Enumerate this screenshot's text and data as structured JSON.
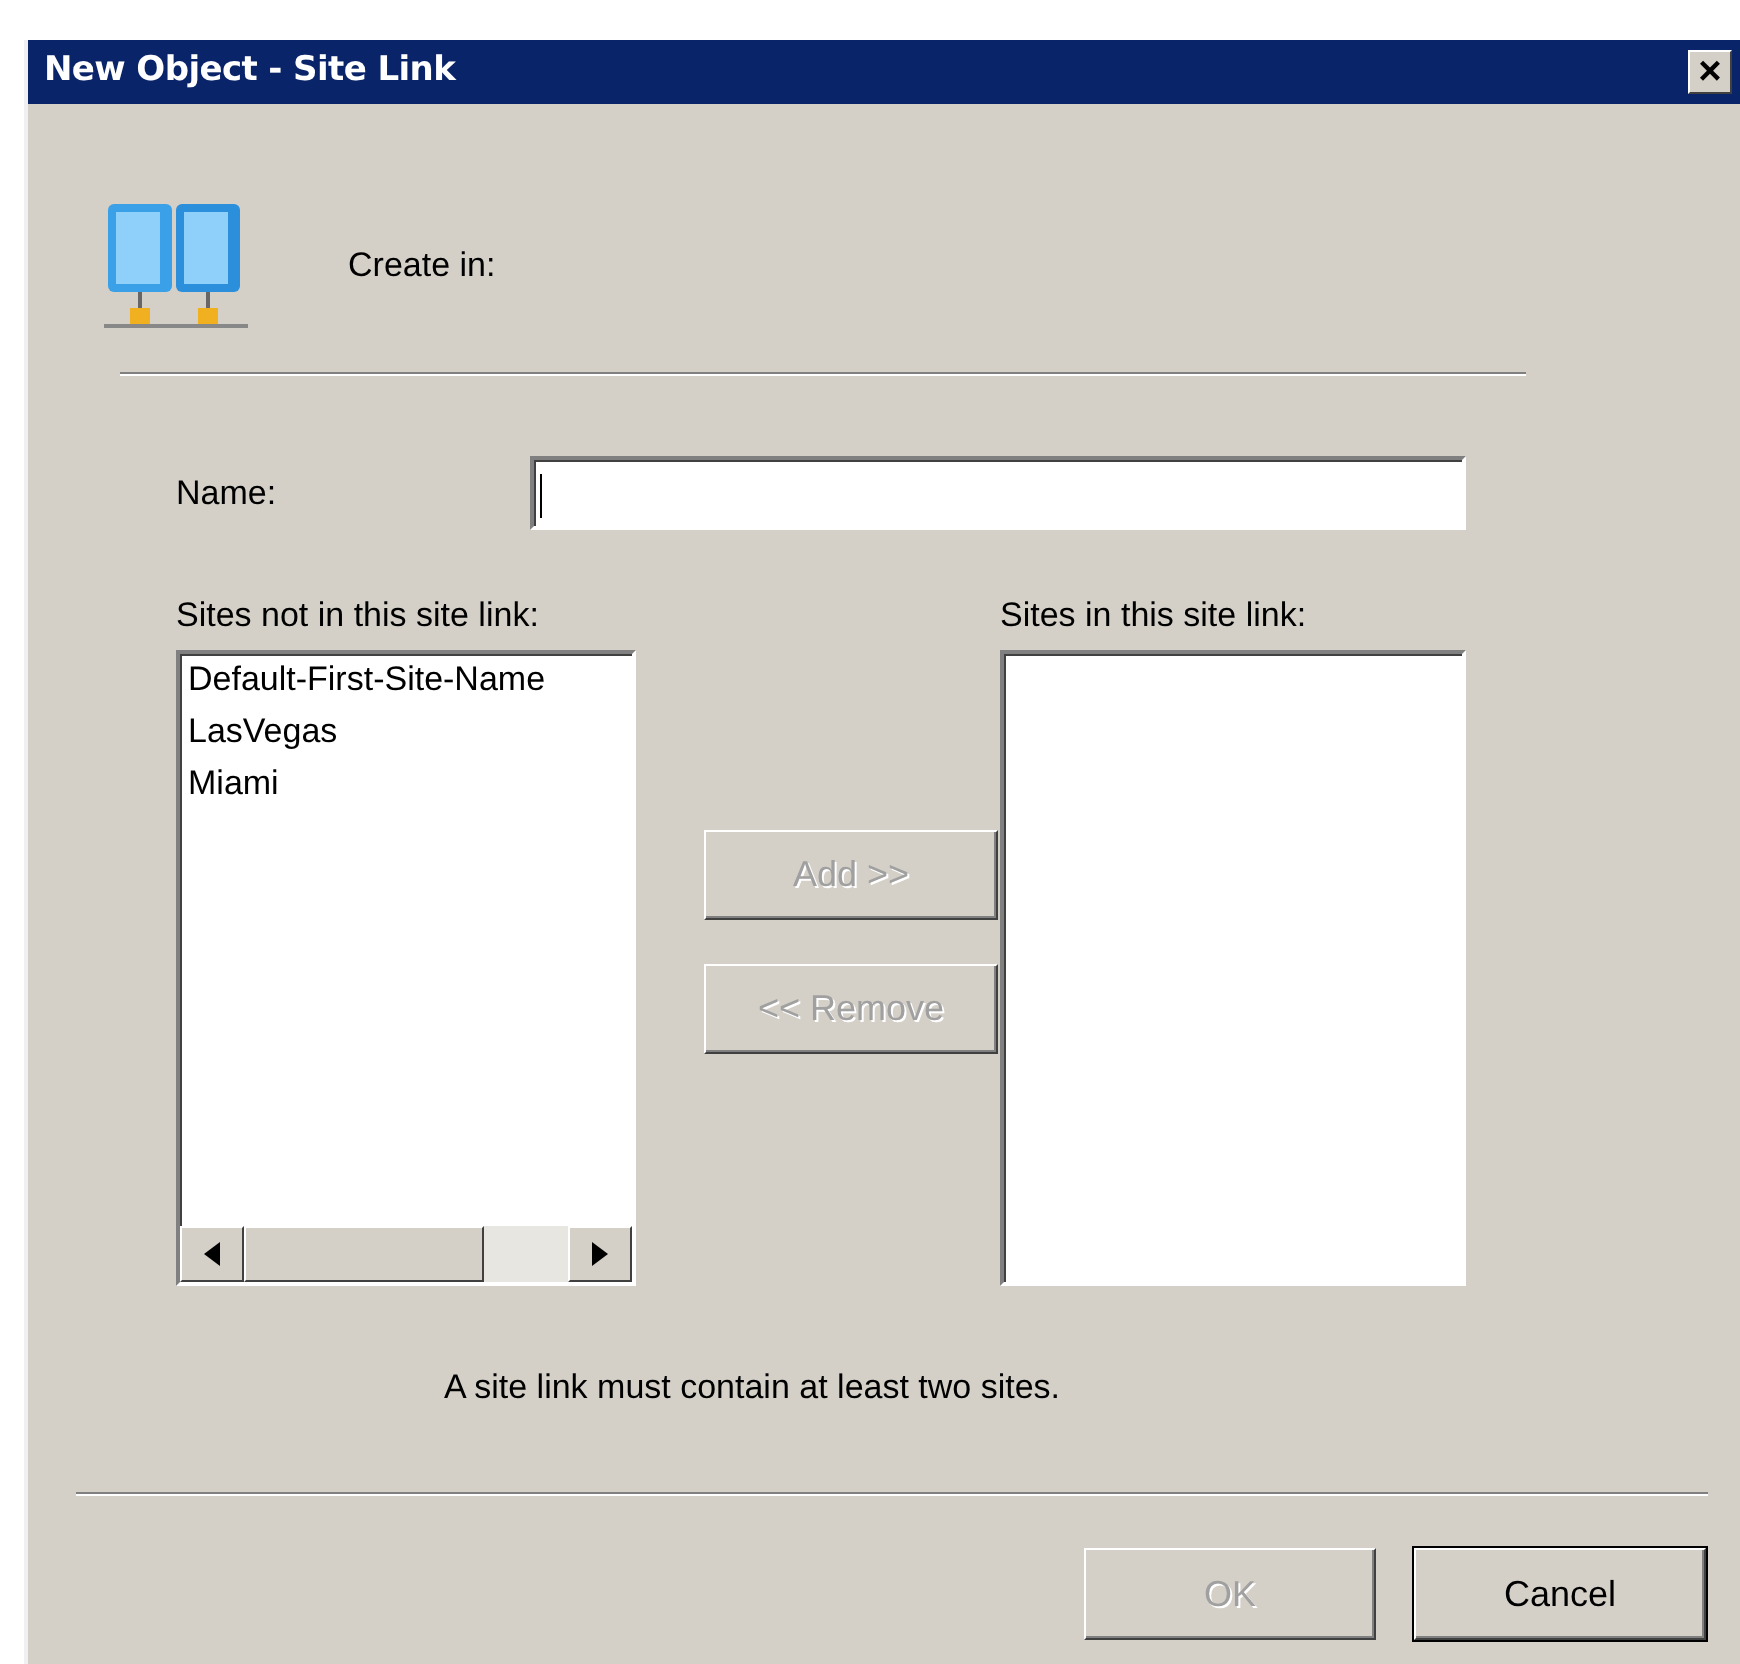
{
  "window": {
    "title": "New Object - Site Link",
    "close": "×"
  },
  "create_in": {
    "label": "Create in:"
  },
  "name_field": {
    "label": "Name:",
    "focused": true
  },
  "available_sites": {
    "label": "Sites not in this site link:",
    "items": [
      {
        "label": "Default-First-Site-Name",
        "selected": false
      },
      {
        "label": "LasVegas",
        "selected": false
      },
      {
        "label": "Miami",
        "selected": false
      }
    ]
  },
  "member_sites": {
    "label": "Sites in this site link:"
  },
  "move_buttons": [
    {
      "label": "Add >>",
      "disabled": true
    },
    {
      "label": "<< Remove",
      "disabled": true
    }
  ],
  "message": "A site link must contain at least two sites.",
  "buttons": [
    {
      "label": "OK",
      "disabled": true,
      "default": false
    },
    {
      "label": "Cancel",
      "disabled": false,
      "default": true
    }
  ]
}
